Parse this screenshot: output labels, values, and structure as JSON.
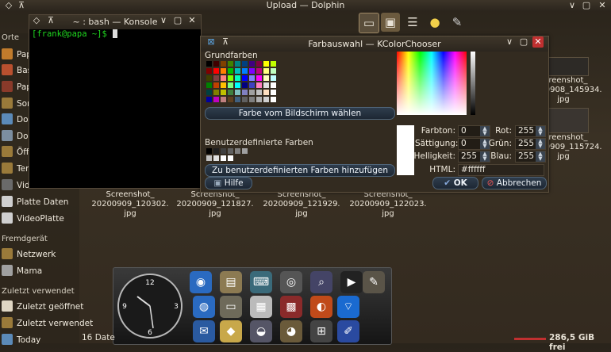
{
  "dolphin": {
    "title": "Upload — Dolphin",
    "status_left": "16 Date",
    "status_right": "286,5 GiB frei"
  },
  "sidebar": {
    "places_header": "Orte",
    "places": [
      "Papa",
      "Basis-Ordner",
      "Papierkorb",
      "Sonstiges",
      "Downloads",
      "Dokumente",
      "Öffentlich",
      "Temp",
      "Videos",
      "Platte Daten",
      "VideoPlatte"
    ],
    "remote_header": "Fremdgerät",
    "remote": [
      "Netzwerk",
      "Mama"
    ],
    "recent_header": "Zuletzt verwendet",
    "recent": [
      "Zuletzt geöffnet",
      "Zuletzt verwendet",
      "Today"
    ]
  },
  "files": [
    {
      "name": "Screenshot_\n20200909_120302.\njpg"
    },
    {
      "name": "Screenshot_\n20200909_121827.\njpg"
    },
    {
      "name": "Screenshot_\n20200909_121929.\njpg"
    },
    {
      "name": "Screenshot_\n20200909_122023.\njpg"
    },
    {
      "name": "Screenshot_\n20200908_145934.\njpg"
    },
    {
      "name": "Screenshot_\n20200909_115724.\njpg"
    }
  ],
  "konsole": {
    "title": "~ : bash — Konsole",
    "prompt": "[frank@papa ~]$ "
  },
  "chooser": {
    "title": "Farbauswahl — KColorChooser",
    "basic_label": "Grundfarben",
    "screen_pick_button": "Farbe vom Bildschirm wählen",
    "custom_label": "Benutzerdefinierte Farben",
    "add_custom_button": "Zu benutzerdefinierten Farben hinzufügen",
    "help_button": "Hilfe",
    "ok_button": "OK",
    "cancel_button": "Abbrechen",
    "fields": {
      "farbton_label": "Farbton:",
      "farbton_value": "0",
      "saettigung_label": "Sättigung:",
      "saettigung_value": "0",
      "helligkeit_label": "Helligkeit:",
      "helligkeit_value": "255",
      "rot_label": "Rot:",
      "rot_value": "255",
      "gruen_label": "Grün:",
      "gruen_value": "255",
      "blau_label": "Blau:",
      "blau_value": "255",
      "html_label": "HTML:",
      "html_value": "#ffffff"
    },
    "swatch_colors": [
      [
        "#000000",
        "#400000",
        "#804000",
        "#408000",
        "#008080",
        "#004080",
        "#400080",
        "#800040",
        "#ffff00",
        "#c0ff00"
      ],
      [
        "#800000",
        "#ff0000",
        "#ff8000",
        "#00c000",
        "#00c0c0",
        "#0080ff",
        "#8000ff",
        "#c00080",
        "#ffff80",
        "#c0ffc0"
      ],
      [
        "#404000",
        "#804040",
        "#ff8080",
        "#80ff00",
        "#00ffc0",
        "#0000ff",
        "#8080ff",
        "#ff00ff",
        "#ffffc0",
        "#c0ffff"
      ],
      [
        "#008000",
        "#c04000",
        "#ffc000",
        "#80ff80",
        "#00ffff",
        "#000080",
        "#4040c0",
        "#ff80c0",
        "#e0e0e0",
        "#ffffff"
      ],
      [
        "#004040",
        "#808000",
        "#c0c000",
        "#408040",
        "#80c0c0",
        "#8080c0",
        "#a0a0a0",
        "#c0c0c0",
        "#ffe0c0",
        "#ffffff"
      ],
      [
        "#0000a0",
        "#c000c0",
        "#c08080",
        "#604020",
        "#406080",
        "#606060",
        "#808080",
        "#b0b0b0",
        "#d0d0d0",
        "#ffffff"
      ]
    ],
    "custom_colors": [
      "#000000",
      "#202020",
      "#404040",
      "#606060",
      "#808080",
      "#a0a0a0",
      "#c0c0c0",
      "#e0e0e0",
      "#ffffff",
      "#ffffff"
    ]
  },
  "dock": {
    "clock_numbers": [
      "12",
      "3",
      "6",
      "9"
    ]
  }
}
